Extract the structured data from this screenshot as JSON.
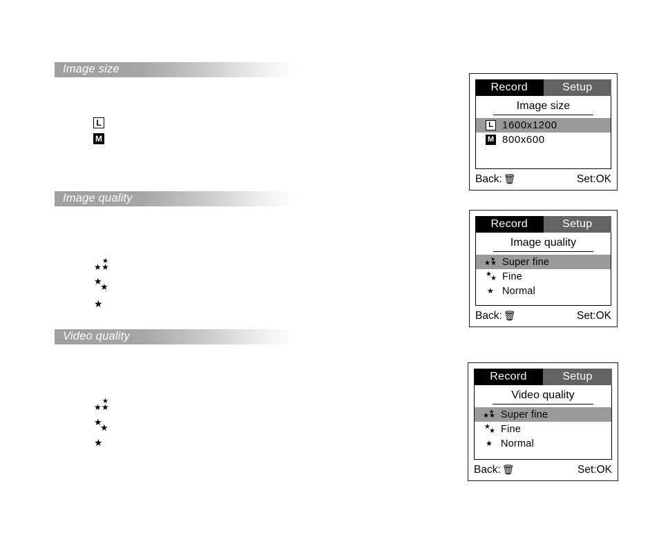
{
  "sections": [
    {
      "id": "image-size",
      "heading": "Image size",
      "icons": [
        {
          "glyph": "L",
          "style": "outline"
        },
        {
          "glyph": "M",
          "style": "filled"
        }
      ]
    },
    {
      "id": "image-quality",
      "heading": "Image quality",
      "icons": []
    },
    {
      "id": "video-quality",
      "heading": "Video quality",
      "icons": []
    }
  ],
  "panels": [
    {
      "id": "panel-image-size",
      "tabs": [
        {
          "label": "Record",
          "state": "active"
        },
        {
          "label": "Setup",
          "state": "inactive"
        }
      ],
      "title": "Image size",
      "rows": [
        {
          "icon": "large-size-icon",
          "glyph": "L",
          "icon_style": "outline",
          "label": "1600x1200",
          "selected": true
        },
        {
          "icon": "medium-size-icon",
          "glyph": "M",
          "icon_style": "filled",
          "label": "800x600",
          "selected": false
        }
      ],
      "footer": {
        "back_label": "Back:",
        "back_icon": "trash-icon",
        "set_label": "Set:OK"
      }
    },
    {
      "id": "panel-image-quality",
      "tabs": [
        {
          "label": "Record",
          "state": "active"
        },
        {
          "label": "Setup",
          "state": "inactive"
        }
      ],
      "title": "Image quality",
      "rows": [
        {
          "icon": "three-stars-icon",
          "stars": 3,
          "label": "Super fine",
          "selected": true
        },
        {
          "icon": "two-stars-icon",
          "stars": 2,
          "label": "Fine",
          "selected": false
        },
        {
          "icon": "one-star-icon",
          "stars": 1,
          "label": "Normal",
          "selected": false
        }
      ],
      "footer": {
        "back_label": "Back:",
        "back_icon": "trash-icon",
        "set_label": "Set:OK"
      }
    },
    {
      "id": "panel-video-quality",
      "tabs": [
        {
          "label": "Record",
          "state": "active"
        },
        {
          "label": "Setup",
          "state": "inactive"
        }
      ],
      "title": "Video quality",
      "rows": [
        {
          "icon": "three-stars-icon",
          "stars": 3,
          "label": "Super fine",
          "selected": true
        },
        {
          "icon": "two-stars-icon",
          "stars": 2,
          "label": "Fine",
          "selected": false
        },
        {
          "icon": "one-star-icon",
          "stars": 1,
          "label": "Normal",
          "selected": false
        }
      ],
      "footer": {
        "back_label": "Back:",
        "back_icon": "trash-icon",
        "set_label": "Set:OK"
      }
    }
  ],
  "left_star_groups": [
    {
      "section": "image-quality",
      "stars": 3
    },
    {
      "section": "image-quality",
      "stars": 2
    },
    {
      "section": "image-quality",
      "stars": 1
    },
    {
      "section": "video-quality",
      "stars": 3
    },
    {
      "section": "video-quality",
      "stars": 2
    },
    {
      "section": "video-quality",
      "stars": 1
    }
  ],
  "colors": {
    "tab_active_bg": "#000000",
    "tab_inactive_bg": "#636363",
    "row_selected_bg": "#9a9a9a",
    "section_bar_start": "#9f9f9f",
    "section_bar_end": "#ffffff",
    "text": "#000000",
    "tab_text": "#ffffff"
  },
  "star_glyph": "★"
}
